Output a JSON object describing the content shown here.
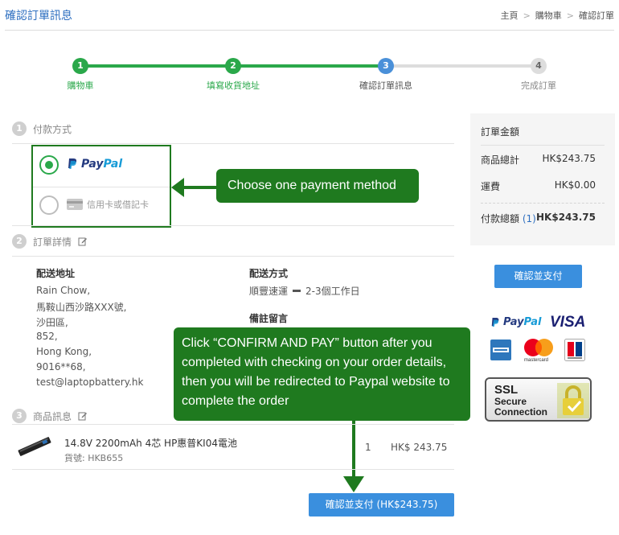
{
  "header": {
    "title": "確認訂單訊息",
    "breadcrumb": [
      "主頁",
      "購物車",
      "確認訂單"
    ],
    "breadcrumb_sep": ">"
  },
  "progress": {
    "steps": [
      {
        "num": "1",
        "label": "購物車",
        "state": "done"
      },
      {
        "num": "2",
        "label": "填寫收貨地址",
        "state": "done"
      },
      {
        "num": "3",
        "label": "確認訂單訊息",
        "state": "current"
      },
      {
        "num": "4",
        "label": "完成訂單",
        "state": "todo"
      }
    ]
  },
  "payment": {
    "section_num": "1",
    "section_title": "付款方式",
    "options": [
      {
        "label_a": "Pay",
        "label_b": "Pal",
        "icon": "paypal-icon",
        "selected": true
      },
      {
        "label": "信用卡或借記卡",
        "icon": "credit-card-icon",
        "selected": false
      }
    ]
  },
  "details": {
    "section_num": "2",
    "section_title": "訂單詳情",
    "address_label": "配送地址",
    "address_lines": [
      "Rain Chow,",
      "馬鞍山西沙路XXX號,",
      "沙田區,",
      "852,",
      "Hong Kong,",
      "9016**68,",
      "test@laptopbattery.hk"
    ],
    "shipping_label": "配送方式",
    "shipping_carrier": "順豐速運",
    "shipping_time": "2-3個工作日",
    "remark_label": "備註留言"
  },
  "products": {
    "section_num": "3",
    "section_title": "商品訊息",
    "items": [
      {
        "name": "14.8V 2200mAh 4芯 HP惠普KI04電池",
        "sku": "貨號: HKB655",
        "qty": "1",
        "price": "HK$ 243.75"
      }
    ]
  },
  "buttons": {
    "confirm_bottom": "確認並支付 (HK$243.75)",
    "confirm_side": "確認並支付"
  },
  "summary": {
    "title": "訂單金額",
    "subtotal_label": "商品總計",
    "subtotal_value": "HK$243.75",
    "shipping_label": "運費",
    "shipping_value": "HK$0.00",
    "total_label": "付款總額",
    "total_count": "(1)",
    "total_value": "HK$243.75"
  },
  "callouts": {
    "payment_hint": "Choose one payment method",
    "confirm_hint": "Click “CONFIRM AND PAY” button after you completed with checking on your order details, then you will be redirected to Paypal website to complete the order"
  },
  "trust": {
    "paypal_a": "Pay",
    "paypal_b": "Pal",
    "visa": "VISA",
    "mastercard": "mastercard",
    "ssl_line1": "SSL",
    "ssl_line2": "Secure",
    "ssl_line3": "Connection"
  },
  "colors": {
    "green": "#2aa84a",
    "callout_green": "#1f7a1f",
    "blue": "#3a8fde",
    "paypal_dark": "#253b80",
    "paypal_light": "#179bd7"
  }
}
